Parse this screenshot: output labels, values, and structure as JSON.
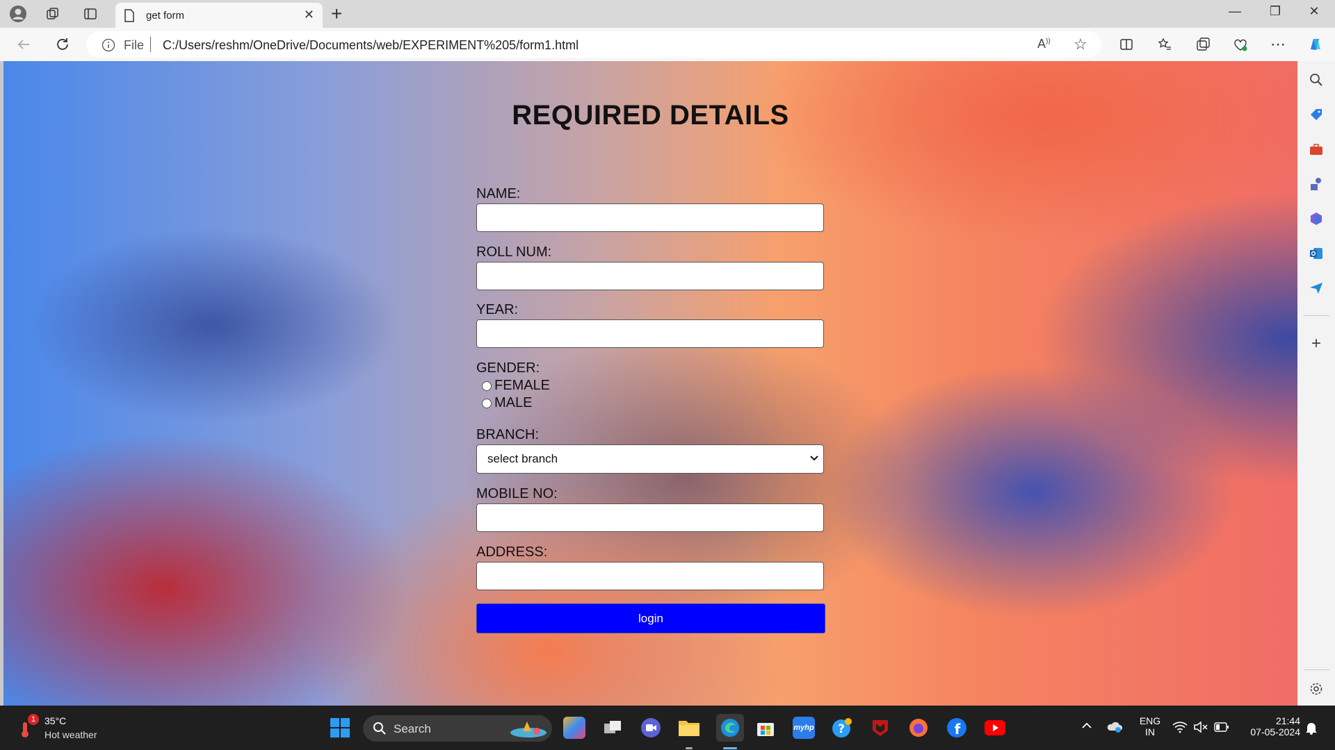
{
  "browser": {
    "tab_title": "get form",
    "address_prefix": "File",
    "url": "C:/Users/reshm/OneDrive/Documents/web/EXPERIMENT%205/form1.html"
  },
  "page": {
    "heading": "REQUIRED DETAILS",
    "fields": {
      "name_label": "NAME:",
      "name_value": "",
      "roll_label": "ROLL NUM:",
      "roll_value": "",
      "year_label": "YEAR:",
      "year_value": "",
      "gender_label": "GENDER:",
      "gender_options": [
        "FEMALE",
        "MALE"
      ],
      "branch_label": "BRANCH:",
      "branch_selected": "select branch",
      "mobile_label": "MOBILE NO:",
      "mobile_value": "",
      "address_label": "ADDRESS:",
      "address_value": ""
    },
    "submit_label": "login"
  },
  "taskbar": {
    "weather_temp": "35°C",
    "weather_desc": "Hot weather",
    "weather_badge": "1",
    "search_placeholder": "Search",
    "lang_top": "ENG",
    "lang_bottom": "IN",
    "time": "21:44",
    "date": "07-05-2024"
  },
  "colors": {
    "submit_button": "#0000ff",
    "taskbar": "#1f1f1f"
  }
}
